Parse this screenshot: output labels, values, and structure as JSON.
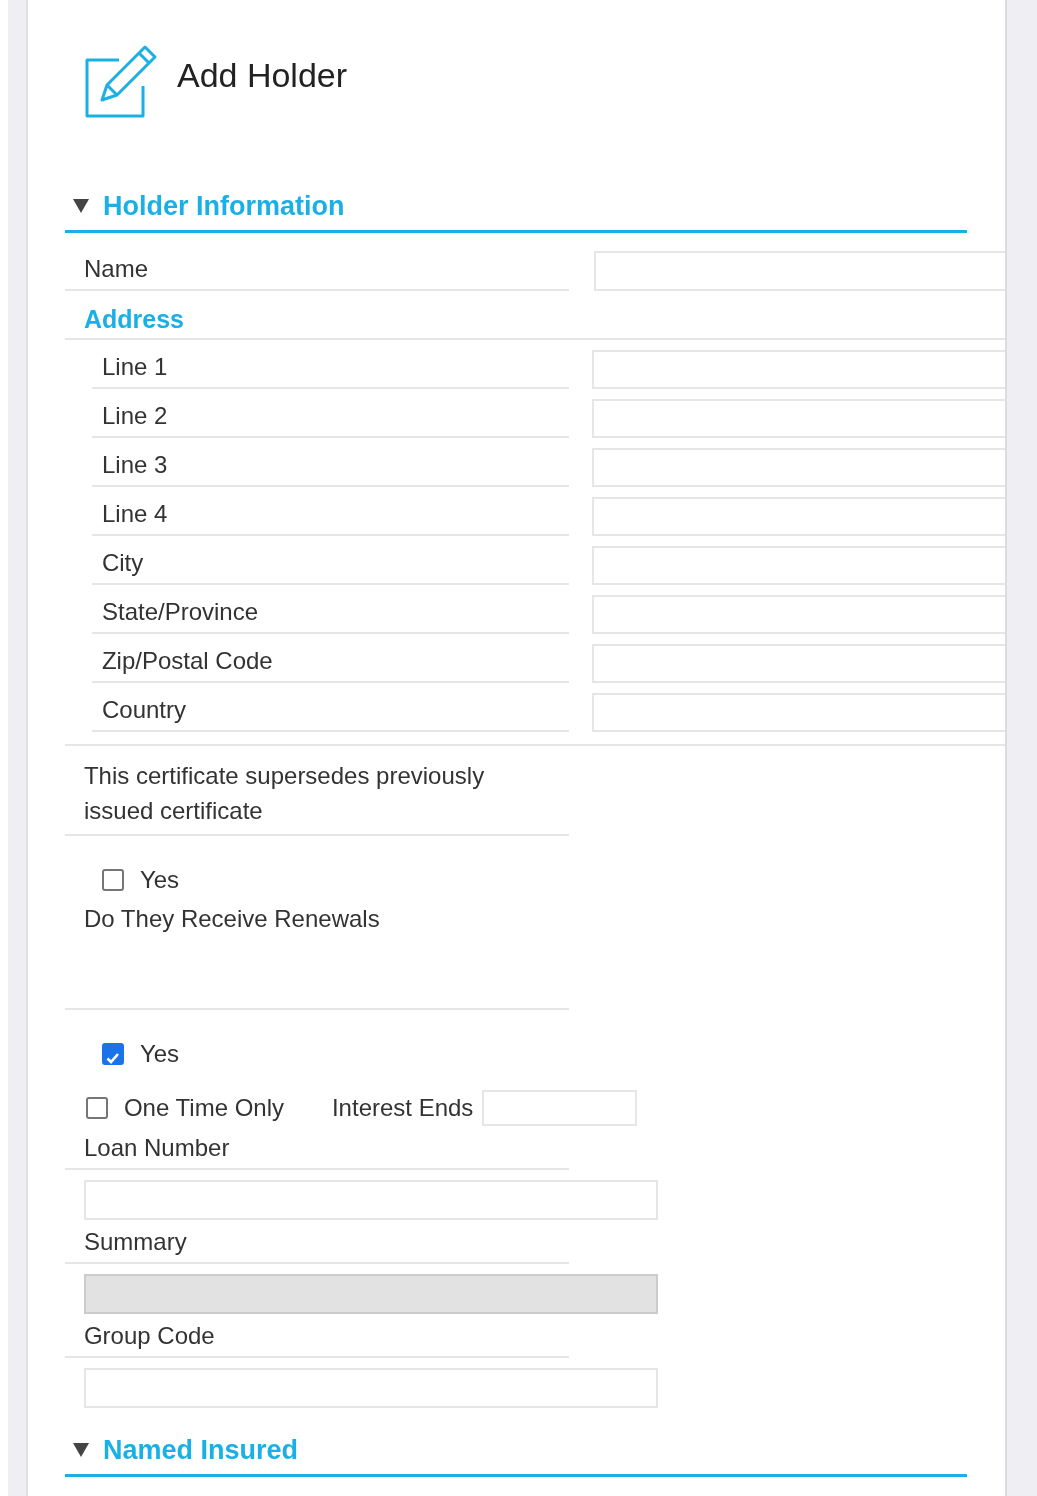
{
  "header": {
    "title": "Add Holder"
  },
  "sections": [
    {
      "title": "Holder Information",
      "expanded": true,
      "fields": [
        {
          "kind": "text",
          "label": "Name"
        },
        {
          "kind": "group",
          "label": "Address",
          "children": [
            {
              "kind": "text",
              "label": "Line 1"
            },
            {
              "kind": "text",
              "label": "Line 2"
            },
            {
              "kind": "text",
              "label": "Line 3"
            },
            {
              "kind": "text",
              "label": "Line 4"
            },
            {
              "kind": "text",
              "label": "City"
            },
            {
              "kind": "text",
              "label": "State/Province"
            },
            {
              "kind": "text",
              "label": "Zip/Postal Code"
            },
            {
              "kind": "text",
              "label": "Country"
            }
          ]
        },
        {
          "kind": "note",
          "label": "This certificate supersedes previously issued certificate"
        },
        {
          "kind": "check",
          "label": "Yes",
          "checked": false
        },
        {
          "kind": "question",
          "label": "Do They Receive Renewals"
        },
        {
          "kind": "check",
          "label": "Yes",
          "checked": true
        },
        {
          "kind": "check_field",
          "label": "One Time Only",
          "checked": false,
          "field_label": "Interest Ends"
        },
        {
          "kind": "stacked",
          "label": "Loan Number",
          "disabled": false
        },
        {
          "kind": "stacked",
          "label": "Summary",
          "disabled": true
        },
        {
          "kind": "stacked",
          "label": "Group Code",
          "disabled": false
        }
      ]
    },
    {
      "title": "Named Insured",
      "expanded": true
    }
  ]
}
